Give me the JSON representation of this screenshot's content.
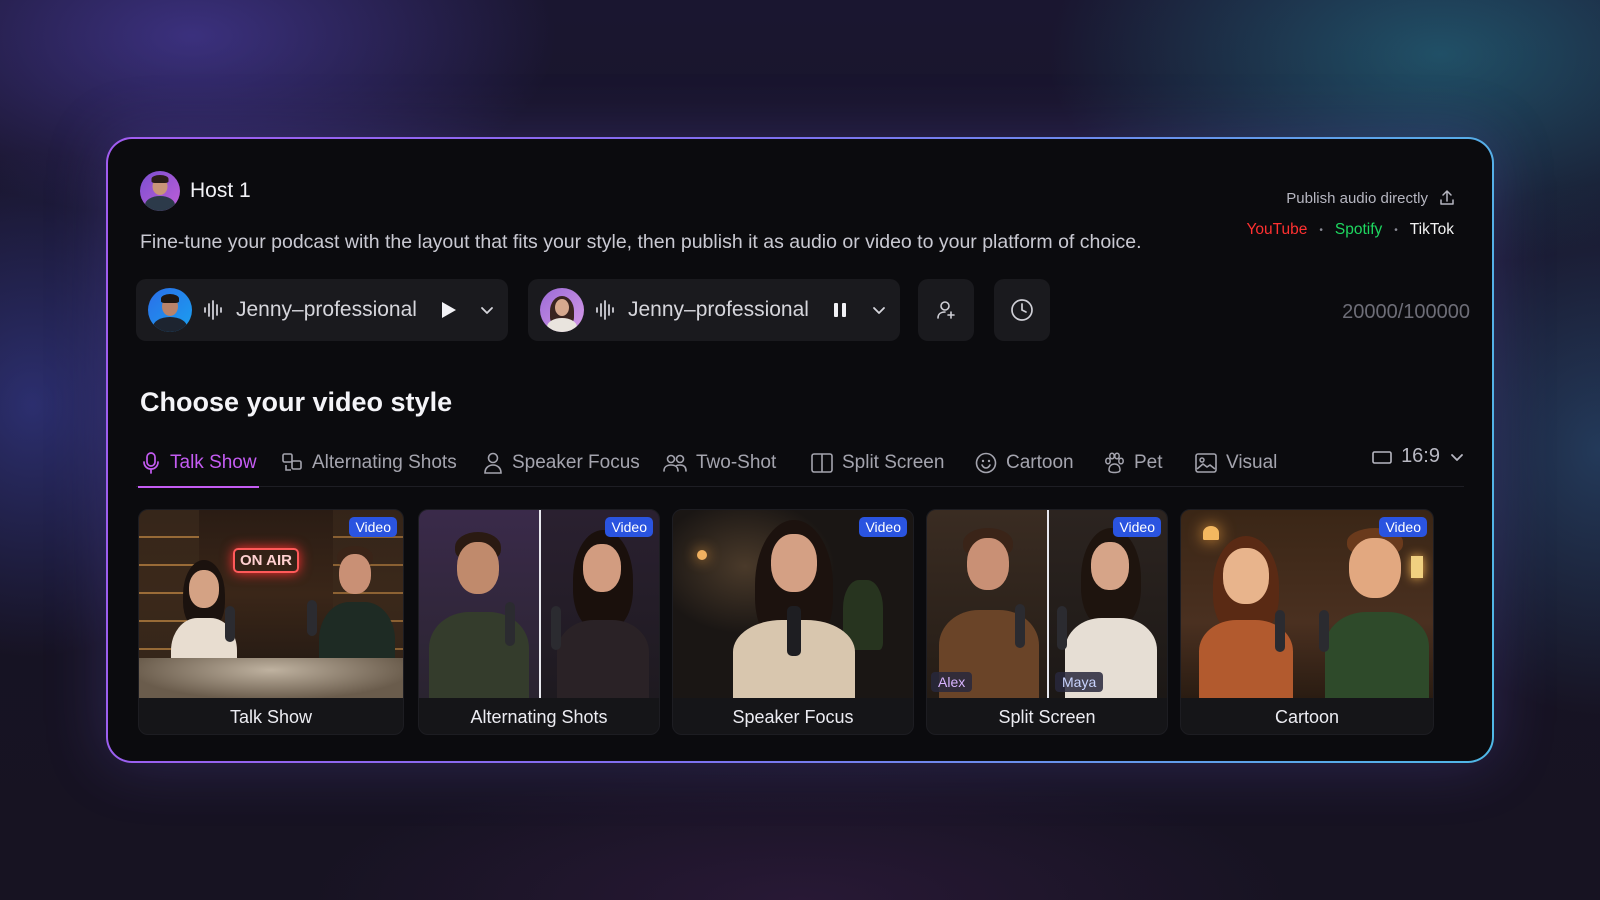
{
  "host": {
    "title": "Host 1"
  },
  "subtitle": "Fine-tune your podcast with the layout that fits your style, then publish it as audio or video to your platform of choice.",
  "publish": {
    "label": "Publish audio directly",
    "platforms": [
      {
        "name": "YouTube",
        "color": "#ff3131"
      },
      {
        "name": "Spotify",
        "color": "#1ed760"
      },
      {
        "name": "TikTok",
        "color": "#f2f2f2"
      }
    ],
    "separator": "•"
  },
  "voices": [
    {
      "name": "Jenny–professional",
      "state": "play"
    },
    {
      "name": "Jenny–professional",
      "state": "pause"
    }
  ],
  "counter": "20000/100000",
  "section_title": "Choose your video style",
  "tabs": [
    {
      "label": "Talk Show",
      "icon": "microphone-icon",
      "active": true
    },
    {
      "label": "Alternating Shots",
      "icon": "alternating-shots-icon"
    },
    {
      "label": "Speaker Focus",
      "icon": "person-icon"
    },
    {
      "label": "Two-Shot",
      "icon": "two-people-icon"
    },
    {
      "label": "Split Screen",
      "icon": "split-screen-icon"
    },
    {
      "label": "Cartoon",
      "icon": "smiley-icon"
    },
    {
      "label": "Pet",
      "icon": "paw-icon"
    },
    {
      "label": "Visual",
      "icon": "image-icon"
    }
  ],
  "aspect_ratio": "16:9",
  "cards": [
    {
      "label": "Talk Show",
      "badge": "Video",
      "sign": "ON AIR"
    },
    {
      "label": "Alternating Shots",
      "badge": "Video"
    },
    {
      "label": "Speaker Focus",
      "badge": "Video"
    },
    {
      "label": "Split Screen",
      "badge": "Video",
      "names": [
        "Alex",
        "Maya"
      ]
    },
    {
      "label": "Cartoon",
      "badge": "Video"
    }
  ]
}
